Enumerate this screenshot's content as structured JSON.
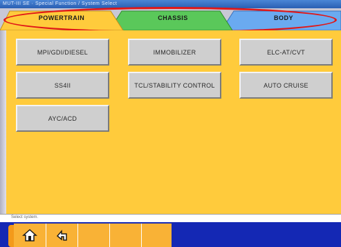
{
  "window": {
    "title": "MUT-III SE  ·  Special Function / System Select"
  },
  "tabs": [
    {
      "label": "POWERTRAIN",
      "color": "#ffcb3c",
      "active": true
    },
    {
      "label": "CHASSIS",
      "color": "#5ac85a",
      "active": false
    },
    {
      "label": "BODY",
      "color": "#6aaaf0",
      "active": false
    }
  ],
  "systems": {
    "mpi_gdi_diesel": "MPI/GDI/DIESEL",
    "immobilizer": "IMMOBILIZER",
    "elc_at_cvt": "ELC-AT/CVT",
    "ss4ii": "SS4II",
    "tcl_stability": "TCL/STABILITY CONTROL",
    "auto_cruise": "AUTO CRUISE",
    "ayc_acd": "AYC/ACD"
  },
  "status": {
    "text": "Select system."
  },
  "toolbar": {
    "home_icon": "home-icon",
    "return_icon": "return-icon"
  },
  "colors": {
    "panel": "#ffcb3c",
    "toolbar": "#1428b4",
    "highlight": "#e01818"
  }
}
